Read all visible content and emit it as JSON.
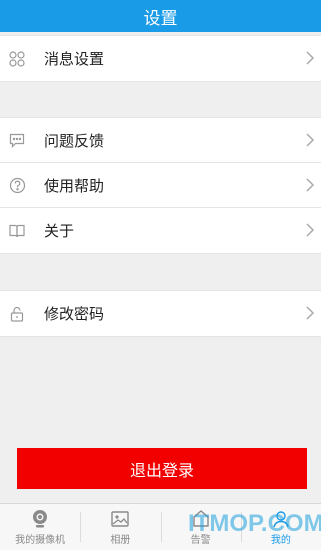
{
  "header": {
    "title": "设置"
  },
  "groups": [
    {
      "items": [
        {
          "label": "消息设置",
          "icon": "apps-grid-icon"
        }
      ]
    },
    {
      "items": [
        {
          "label": "问题反馈",
          "icon": "feedback-chat-icon"
        },
        {
          "label": "使用帮助",
          "icon": "help-question-icon"
        },
        {
          "label": "关于",
          "icon": "book-icon"
        }
      ]
    },
    {
      "items": [
        {
          "label": "修改密码",
          "icon": "lock-icon"
        }
      ]
    }
  ],
  "logout": {
    "label": "退出登录",
    "color": "#f20000"
  },
  "tabbar": {
    "tabs": [
      {
        "label": "我的摄像机",
        "icon": "camera-icon"
      },
      {
        "label": "相册",
        "icon": "photo-album-icon"
      },
      {
        "label": "告警",
        "icon": "alarm-icon"
      },
      {
        "label": "我的",
        "icon": "user-icon",
        "active": true
      }
    ]
  },
  "watermark": {
    "text": "ITMOP.COM"
  },
  "colors": {
    "accent": "#1a9be8",
    "background": "#efefef"
  }
}
